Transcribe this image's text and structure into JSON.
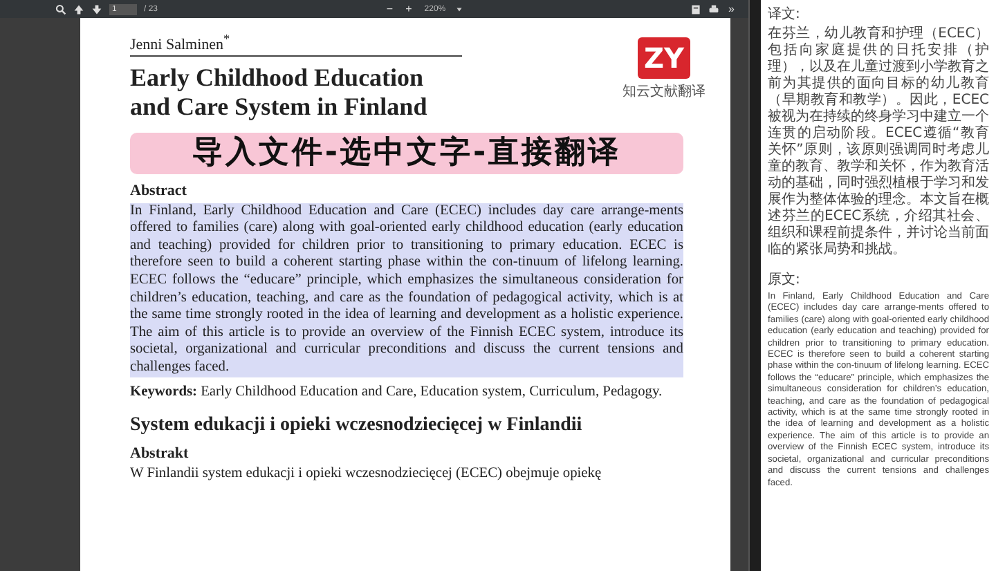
{
  "toolbar": {
    "page_input": "1",
    "page_total": "/ 23",
    "zoom_out": "−",
    "zoom_in": "+",
    "zoom": "220%",
    "expand": "»"
  },
  "document": {
    "author": "Jenni Salminen$^{*}$",
    "title": [
      "Early Childhood Education",
      "and Care System in Finland"
    ],
    "logo": {
      "mark": "ZY",
      "caption": "知云文献翻译"
    },
    "banner": "导入文件-选中文字-直接翻译",
    "abstract_heading": "Abstract",
    "abstract": {
      "text": "In Finland, Early Childhood Education and Care (ECEC) includes day care arrange-ments offered to families (care) along with goal-oriented early childhood education (early education and teaching) provided for children prior to transitioning to primary education. ECEC is therefore seen to build a coherent starting phase within the con-tinuum of lifelong learning. ECEC follows the “educare” principle, which emphasizes the simultaneous consideration for children’s education, teaching, and care as the foundation of pedagogical activity, which is at the same time strongly rooted in the idea of learning and development as a holistic experience. The aim of this article is to provide an overview of the Finnish ECEC system, introduce its societal, organizational and curricular preconditions and discuss the current tensions and challenges faced.",
      "selected": true
    },
    "keywords": "**Keywords:** Early Childhood Education and Care, Education system, Curriculum, Pedagogy.",
    "section_heading": "System edukacji i opieki wczesnodziecięcej w Finlandii",
    "abstrakt_heading": "Abstrakt",
    "polish_text": "W Finlandii system edukacji i opieki wczesnodziecięcej (ECEC) obejmuje opiekę"
  },
  "panel": {
    "translation_heading": "译文:",
    "translation": "在芬兰，幼儿教育和护理（ECEC）包括向家庭提供的日托安排（护理），以及在儿童过渡到小学教育之前为其提供的面向目标的幼儿教育（早期教育和教学）。因此，ECEC被视为在持续的终身学习中建立一个连贯的启动阶段。ECEC遵循“教育关怀”原则，该原则强调同时考虑儿童的教育、教学和关怀，作为教育活动的基础，同时强烈植根于学习和发展作为整体体验的理念。本文旨在概述芬兰的ECEC系统，介绍其社会、组织和课程前提条件，并讨论当前面临的紧张局势和挑战。",
    "original_heading": "原文:",
    "original": "In Finland, Early Childhood Education and Care (ECEC) includes day care arrange-ments offered to families (care) along with goal-oriented early childhood education (early education and teaching) provided for children prior to transitioning to primary education. ECEC is therefore seen to build a coherent starting phase within the con-tinuum of lifelong learning. ECEC follows the “educare” principle, which emphasizes the simultaneous consideration for children’s education, teaching, and care as the foundation of pedagogical activity, which is at the same time strongly rooted in the idea of learning and development as a holistic experience. The aim of this article is to provide an overview of the Finnish ECEC system, introduce its societal, organizational and curricular preconditions and discuss the current tensions and challenges faced."
  }
}
